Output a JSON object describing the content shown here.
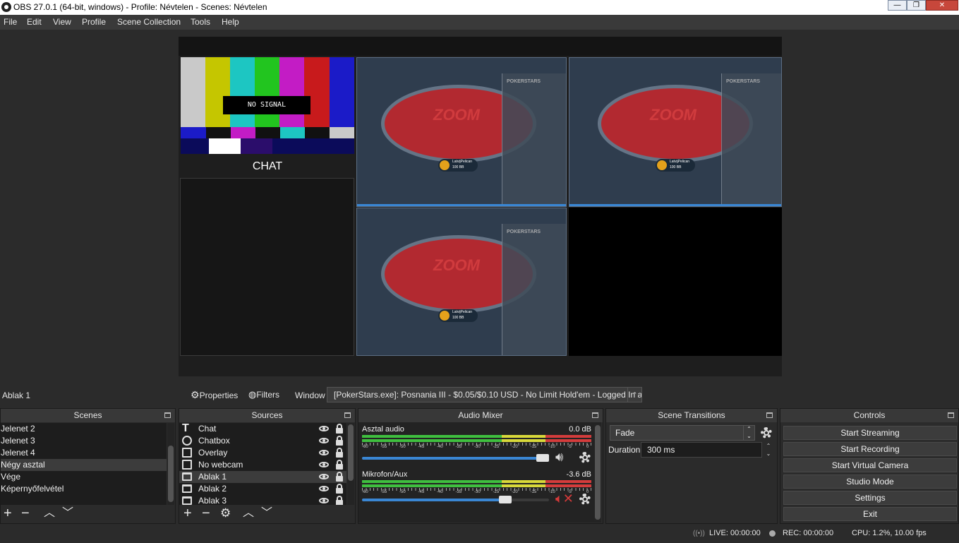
{
  "window": {
    "title": "OBS 27.0.1 (64-bit, windows) - Profile: Névtelen - Scenes: Névtelen",
    "minimize": "—",
    "restore": "❐",
    "close": "✕"
  },
  "menu": [
    "File",
    "Edit",
    "View",
    "Profile",
    "Scene Collection",
    "Tools",
    "Help"
  ],
  "preview": {
    "no_signal": "NO SIGNAL",
    "chat_label": "CHAT",
    "table_brand": "ZOOM",
    "table_panel": "POKERSTARS",
    "player_name": "LatvijPelican",
    "player_stack": "100 BB"
  },
  "source_bar": {
    "selected": "Ablak 1",
    "properties": "Properties",
    "filters": "Filters",
    "window_label": "Window",
    "window_value": "[PokerStars.exe]: Posnania III - $0.05/$0.10 USD - No Limit Hold'em - Logged In as Lal"
  },
  "scenes": {
    "title": "Scenes",
    "items": [
      "Jelenet 2",
      "Jelenet 3",
      "Jelenet 4",
      "Négy asztal",
      "Vége",
      "Képernyőfelvétel"
    ],
    "selected": "Négy asztal"
  },
  "sources": {
    "title": "Sources",
    "items": [
      {
        "name": "Chat",
        "icon": "text-icon"
      },
      {
        "name": "Chatbox",
        "icon": "browser-icon"
      },
      {
        "name": "Overlay",
        "icon": "image-icon"
      },
      {
        "name": "No webcam",
        "icon": "image-icon"
      },
      {
        "name": "Ablak 1",
        "icon": "window-icon"
      },
      {
        "name": "Ablak 2",
        "icon": "window-icon"
      },
      {
        "name": "Ablak 3",
        "icon": "window-icon"
      }
    ],
    "selected": "Ablak 1"
  },
  "mixer": {
    "title": "Audio Mixer",
    "ticks": [
      "-60",
      "-55",
      "-50",
      "-45",
      "-40",
      "-35",
      "-30",
      "-25",
      "-20",
      "-15",
      "-10",
      "-5",
      "0"
    ],
    "channels": [
      {
        "name": "Asztal audio",
        "db": "0.0 dB",
        "volume": 1.0,
        "muted": false
      },
      {
        "name": "Mikrofon/Aux",
        "db": "-3.6 dB",
        "volume": 0.8,
        "muted": true
      }
    ]
  },
  "transitions": {
    "title": "Scene Transitions",
    "selected": "Fade",
    "duration_label": "Duration",
    "duration_value": "300 ms"
  },
  "controls": {
    "title": "Controls",
    "buttons": [
      "Start Streaming",
      "Start Recording",
      "Start Virtual Camera",
      "Studio Mode",
      "Settings",
      "Exit"
    ]
  },
  "status": {
    "live": "LIVE: 00:00:00",
    "rec": "REC: 00:00:00",
    "cpu": "CPU: 1.2%, 10.00 fps"
  },
  "colors": {
    "accent": "#3a86d3",
    "felt": "#c1272d",
    "muted": "#d63a3a"
  }
}
